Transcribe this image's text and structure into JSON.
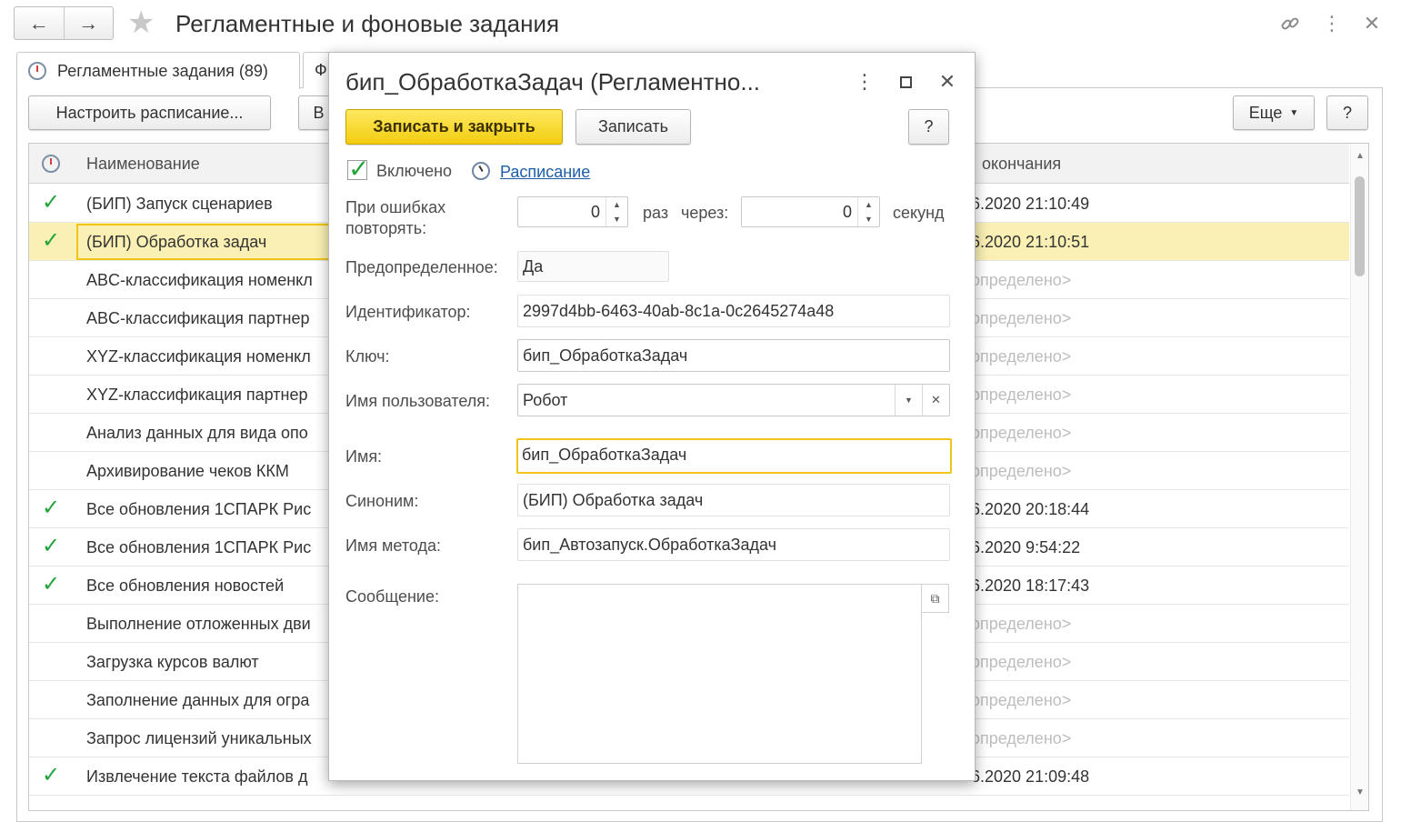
{
  "header": {
    "back_icon": "arrow-left-icon",
    "forward_icon": "arrow-right-icon",
    "title": "Регламентные и фоновые задания",
    "link_icon": "link-icon",
    "more_icon": "vertical-dots-icon",
    "close_icon": "close-icon"
  },
  "tabs": [
    {
      "label": "Регламентные задания (89)",
      "active": true
    },
    {
      "label": "Ф",
      "active": false
    }
  ],
  "toolbar": {
    "schedule_button": "Настроить расписание...",
    "second_button": "В",
    "more_button": "Еще",
    "help_button": "?"
  },
  "table": {
    "columns": [
      "Наименование",
      "окончания"
    ],
    "rows": [
      {
        "checked": true,
        "name": "(БИП) Запуск сценариев",
        "end": "6.2020 21:10:49",
        "selected": false
      },
      {
        "checked": true,
        "name": "(БИП) Обработка задач",
        "end": "6.2020 21:10:51",
        "selected": true
      },
      {
        "checked": false,
        "name": "ABC-классификация номенкл",
        "end": "определено>",
        "selected": false
      },
      {
        "checked": false,
        "name": "ABC-классификация партнер",
        "end": "определено>",
        "selected": false
      },
      {
        "checked": false,
        "name": "XYZ-классификация номенкл",
        "end": "определено>",
        "selected": false
      },
      {
        "checked": false,
        "name": "XYZ-классификация партнер",
        "end": "определено>",
        "selected": false
      },
      {
        "checked": false,
        "name": "Анализ данных для вида опо",
        "end": "определено>",
        "selected": false
      },
      {
        "checked": false,
        "name": "Архивирование чеков ККМ",
        "end": "определено>",
        "selected": false
      },
      {
        "checked": true,
        "name": "Все обновления 1СПАРК Рис",
        "end": "6.2020 20:18:44",
        "selected": false
      },
      {
        "checked": true,
        "name": "Все обновления 1СПАРК Рис",
        "end": "6.2020 9:54:22",
        "selected": false
      },
      {
        "checked": true,
        "name": "Все обновления новостей",
        "end": "6.2020 18:17:43",
        "selected": false
      },
      {
        "checked": false,
        "name": "Выполнение отложенных дви",
        "end": "определено>",
        "selected": false
      },
      {
        "checked": false,
        "name": "Загрузка курсов валют",
        "end": "определено>",
        "selected": false
      },
      {
        "checked": false,
        "name": "Заполнение данных для огра",
        "end": "определено>",
        "selected": false
      },
      {
        "checked": false,
        "name": "Запрос лицензий уникальных",
        "end": "определено>",
        "selected": false
      },
      {
        "checked": true,
        "name": "Извлечение текста файлов д",
        "end": "6.2020 21:09:48",
        "selected": false
      }
    ]
  },
  "dialog": {
    "title": "бип_ОбработкаЗадач (Регламентно...",
    "more_icon": "vertical-dots-icon",
    "maximize_icon": "maximize-icon",
    "close_icon": "close-icon",
    "save_close_button": "Записать и закрыть",
    "save_button": "Записать",
    "help_button": "?",
    "enabled_label": "Включено",
    "schedule_link": "Расписание",
    "retry_label": "При ошибках повторять:",
    "retry_count": "0",
    "times_label": "раз",
    "after_label": "через:",
    "retry_interval": "0",
    "seconds_label": "секунд",
    "predefined_label": "Предопределенное:",
    "predefined_value": "Да",
    "id_label": "Идентификатор:",
    "id_value": "2997d4bb-6463-40ab-8c1a-0c2645274a48",
    "key_label": "Ключ:",
    "key_value": "бип_ОбработкаЗадач",
    "user_label": "Имя пользователя:",
    "user_value": "Робот",
    "name_label": "Имя:",
    "name_value": "бип_ОбработкаЗадач",
    "synonym_label": "Синоним:",
    "synonym_value": "(БИП) Обработка задач",
    "method_label": "Имя метода:",
    "method_value": "бип_Автозапуск.ОбработкаЗадач",
    "message_label": "Сообщение:",
    "message_value": ""
  }
}
